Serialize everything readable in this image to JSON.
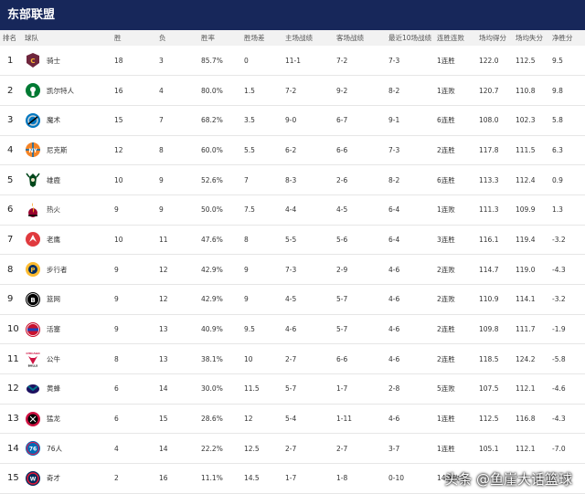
{
  "title": "东部联盟",
  "columns": [
    "排名",
    "球队",
    "胜",
    "负",
    "胜率",
    "胜场差",
    "主场战绩",
    "客场战绩",
    "最近10场战绩",
    "连胜连败",
    "场均得分",
    "场均失分",
    "净胜分"
  ],
  "rows": [
    {
      "rank": "1",
      "team": "骑士",
      "logo": "cavaliers-logo-icon",
      "w": "18",
      "l": "3",
      "pct": "85.7%",
      "gb": "0",
      "home": "11-1",
      "away": "7-2",
      "last10": "7-3",
      "streak": "1连胜",
      "ppg": "122.0",
      "oppg": "112.5",
      "diff": "9.5"
    },
    {
      "rank": "2",
      "team": "凯尔特人",
      "logo": "celtics-logo-icon",
      "w": "16",
      "l": "4",
      "pct": "80.0%",
      "gb": "1.5",
      "home": "7-2",
      "away": "9-2",
      "last10": "8-2",
      "streak": "1连败",
      "ppg": "120.7",
      "oppg": "110.8",
      "diff": "9.8"
    },
    {
      "rank": "3",
      "team": "魔术",
      "logo": "magic-logo-icon",
      "w": "15",
      "l": "7",
      "pct": "68.2%",
      "gb": "3.5",
      "home": "9-0",
      "away": "6-7",
      "last10": "9-1",
      "streak": "6连胜",
      "ppg": "108.0",
      "oppg": "102.3",
      "diff": "5.8"
    },
    {
      "rank": "4",
      "team": "尼克斯",
      "logo": "knicks-logo-icon",
      "w": "12",
      "l": "8",
      "pct": "60.0%",
      "gb": "5.5",
      "home": "6-2",
      "away": "6-6",
      "last10": "7-3",
      "streak": "2连胜",
      "ppg": "117.8",
      "oppg": "111.5",
      "diff": "6.3"
    },
    {
      "rank": "5",
      "team": "雄鹿",
      "logo": "bucks-logo-icon",
      "w": "10",
      "l": "9",
      "pct": "52.6%",
      "gb": "7",
      "home": "8-3",
      "away": "2-6",
      "last10": "8-2",
      "streak": "6连胜",
      "ppg": "113.3",
      "oppg": "112.4",
      "diff": "0.9"
    },
    {
      "rank": "6",
      "team": "热火",
      "logo": "heat-logo-icon",
      "w": "9",
      "l": "9",
      "pct": "50.0%",
      "gb": "7.5",
      "home": "4-4",
      "away": "4-5",
      "last10": "6-4",
      "streak": "1连败",
      "ppg": "111.3",
      "oppg": "109.9",
      "diff": "1.3"
    },
    {
      "rank": "7",
      "team": "老鹰",
      "logo": "hawks-logo-icon",
      "w": "10",
      "l": "11",
      "pct": "47.6%",
      "gb": "8",
      "home": "5-5",
      "away": "5-6",
      "last10": "6-4",
      "streak": "3连胜",
      "ppg": "116.1",
      "oppg": "119.4",
      "diff": "-3.2"
    },
    {
      "rank": "8",
      "team": "步行者",
      "logo": "pacers-logo-icon",
      "w": "9",
      "l": "12",
      "pct": "42.9%",
      "gb": "9",
      "home": "7-3",
      "away": "2-9",
      "last10": "4-6",
      "streak": "2连败",
      "ppg": "114.7",
      "oppg": "119.0",
      "diff": "-4.3"
    },
    {
      "rank": "9",
      "team": "篮网",
      "logo": "nets-logo-icon",
      "w": "9",
      "l": "12",
      "pct": "42.9%",
      "gb": "9",
      "home": "4-5",
      "away": "5-7",
      "last10": "4-6",
      "streak": "2连败",
      "ppg": "110.9",
      "oppg": "114.1",
      "diff": "-3.2"
    },
    {
      "rank": "10",
      "team": "活塞",
      "logo": "pistons-logo-icon",
      "w": "9",
      "l": "13",
      "pct": "40.9%",
      "gb": "9.5",
      "home": "4-6",
      "away": "5-7",
      "last10": "4-6",
      "streak": "2连胜",
      "ppg": "109.8",
      "oppg": "111.7",
      "diff": "-1.9"
    },
    {
      "rank": "11",
      "team": "公牛",
      "logo": "bulls-logo-icon",
      "w": "8",
      "l": "13",
      "pct": "38.1%",
      "gb": "10",
      "home": "2-7",
      "away": "6-6",
      "last10": "4-6",
      "streak": "2连胜",
      "ppg": "118.5",
      "oppg": "124.2",
      "diff": "-5.8"
    },
    {
      "rank": "12",
      "team": "黄蜂",
      "logo": "hornets-logo-icon",
      "w": "6",
      "l": "14",
      "pct": "30.0%",
      "gb": "11.5",
      "home": "5-7",
      "away": "1-7",
      "last10": "2-8",
      "streak": "5连败",
      "ppg": "107.5",
      "oppg": "112.1",
      "diff": "-4.6"
    },
    {
      "rank": "13",
      "team": "猛龙",
      "logo": "raptors-logo-icon",
      "w": "6",
      "l": "15",
      "pct": "28.6%",
      "gb": "12",
      "home": "5-4",
      "away": "1-11",
      "last10": "4-6",
      "streak": "1连胜",
      "ppg": "112.5",
      "oppg": "116.8",
      "diff": "-4.3"
    },
    {
      "rank": "14",
      "team": "76人",
      "logo": "76ers-logo-icon",
      "w": "4",
      "l": "14",
      "pct": "22.2%",
      "gb": "12.5",
      "home": "2-7",
      "away": "2-7",
      "last10": "3-7",
      "streak": "1连胜",
      "ppg": "105.1",
      "oppg": "112.1",
      "diff": "-7.0"
    },
    {
      "rank": "15",
      "team": "奇才",
      "logo": "wizards-logo-icon",
      "w": "2",
      "l": "16",
      "pct": "11.1%",
      "gb": "14.5",
      "home": "1-7",
      "away": "1-8",
      "last10": "0-10",
      "streak": "14连败",
      "ppg": "",
      "oppg": "",
      "diff": ""
    }
  ],
  "watermark": "头条 @鱼崖大话篮球",
  "colors": {
    "header_bg": "#17275a",
    "row_border": "#e6e6e6",
    "thead_bg": "#f2f2f2"
  }
}
